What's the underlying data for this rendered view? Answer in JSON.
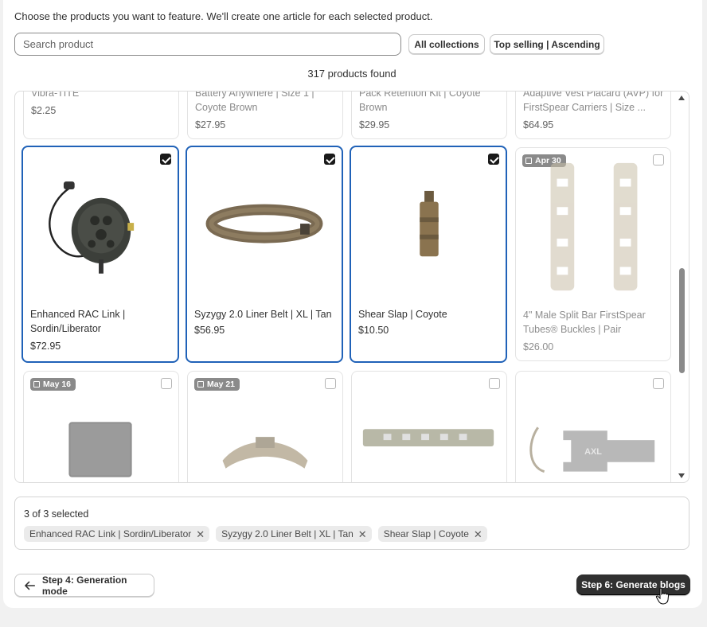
{
  "intro_text": "Choose the products you want to feature. We'll create one article for each selected product.",
  "search": {
    "placeholder": "Search product",
    "value": ""
  },
  "filters": {
    "collections": "All collections",
    "sort": "Top selling | Ascending"
  },
  "products_found": "317 products found",
  "top_row_partial": [
    {
      "title_visible": "Vibra-TITE",
      "price": "$2.25"
    },
    {
      "title_visible": "Battery Anywhere | Size 1 | Coyote Brown",
      "price": "$27.95"
    },
    {
      "title_visible": "Pack Retention Kit | Coyote Brown",
      "price": "$29.95"
    },
    {
      "title_visible": "Adaptive Vest Placard (AVP) for FirstSpear Carriers | Size ...",
      "price": "$64.95"
    }
  ],
  "middle_row": [
    {
      "title": "Enhanced RAC Link | Sordin/Liberator",
      "price": "$72.95",
      "selected": true,
      "image": "headset-icon"
    },
    {
      "title": "Syzygy 2.0 Liner Belt | XL | Tan",
      "price": "$56.95",
      "selected": true,
      "image": "belt-icon"
    },
    {
      "title": "Shear Slap | Coyote",
      "price": "$10.50",
      "selected": true,
      "image": "pouch-icon"
    },
    {
      "title": "4\" Male Split Bar FirstSpear Tubes® Buckles | Pair",
      "price": "$26.00",
      "selected": false,
      "date": "Apr 30",
      "image": "buckle-bars-icon"
    }
  ],
  "bottom_row": [
    {
      "date": "May 16",
      "image": "mesh-panel-icon"
    },
    {
      "date": "May 21",
      "image": "padded-strap-icon"
    },
    {
      "image": "laser-cut-panel-icon"
    },
    {
      "image": "axl-plate-icon",
      "image_text": "AXL"
    }
  ],
  "selection": {
    "count_text": "3 of 3 selected",
    "tags": [
      "Enhanced RAC Link | Sordin/Liberator",
      "Syzygy 2.0 Liner Belt | XL | Tan",
      "Shear Slap | Coyote"
    ]
  },
  "nav": {
    "back_label": "Step 4: Generation mode",
    "next_label": "Step 6: Generate blogs"
  },
  "colors": {
    "selected_border": "#2062b8",
    "primary_button": "#303030",
    "badge": "#8a8a8a"
  }
}
